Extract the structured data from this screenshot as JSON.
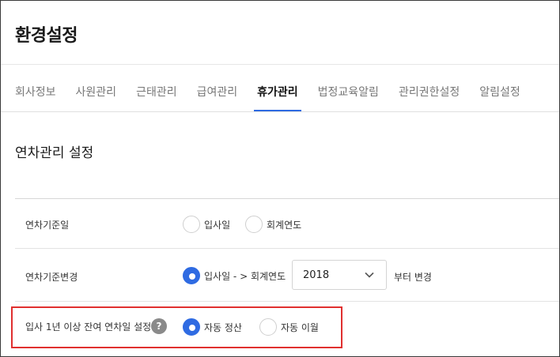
{
  "page": {
    "title": "환경설정"
  },
  "tabs": [
    {
      "label": "회사정보",
      "active": false
    },
    {
      "label": "사원관리",
      "active": false
    },
    {
      "label": "근태관리",
      "active": false
    },
    {
      "label": "급여관리",
      "active": false
    },
    {
      "label": "휴가관리",
      "active": true
    },
    {
      "label": "법정교육알림",
      "active": false
    },
    {
      "label": "관리권한설정",
      "active": false
    },
    {
      "label": "알림설정",
      "active": false
    }
  ],
  "section": {
    "title": "연차관리 설정"
  },
  "rows": {
    "base_date": {
      "label": "연차기준일",
      "options": [
        {
          "label": "입사일",
          "selected": false
        },
        {
          "label": "회계연도",
          "selected": false
        }
      ]
    },
    "base_change": {
      "label": "연차기준변경",
      "option": {
        "label": "입사일 - > 회계연도",
        "selected": true
      },
      "select_value": "2018",
      "after_text": "부터 변경"
    },
    "leftover": {
      "label": "입사 1년 이상 잔여 연차일 설정",
      "help_symbol": "?",
      "options": [
        {
          "label": "자동 정산",
          "selected": true
        },
        {
          "label": "자동 이월",
          "selected": false
        }
      ]
    }
  },
  "colors": {
    "accent": "#2f6be2",
    "highlight_border": "#e0302f",
    "help_badge": "#8a8a8a"
  },
  "icons": {
    "select_arrow": "chevron-down-icon",
    "help": "question-mark-icon"
  }
}
